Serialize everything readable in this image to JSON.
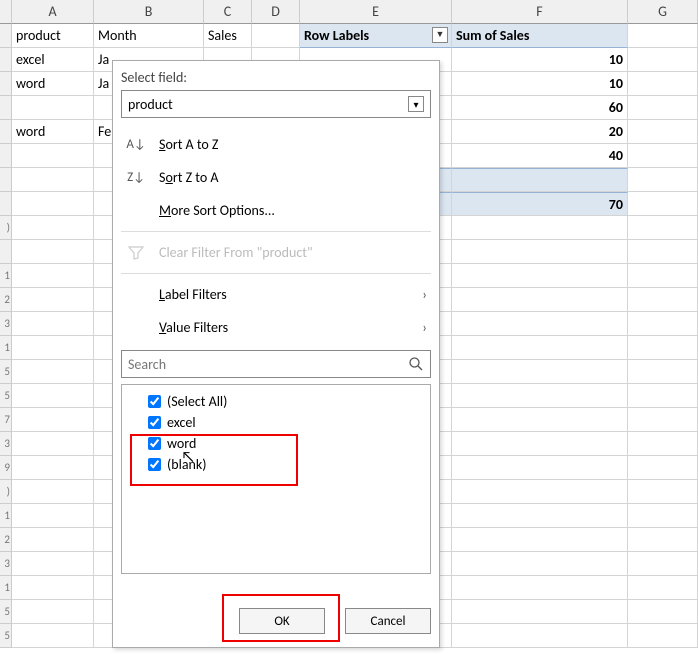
{
  "col_headers": [
    "A",
    "B",
    "C",
    "D",
    "E",
    "F",
    "G"
  ],
  "spreadsheet": {
    "r1": {
      "A": "product",
      "B": "Month",
      "C": "Sales",
      "E": "Row Labels",
      "F": "Sum of Sales"
    },
    "r2": {
      "A": "excel",
      "B": "Ja",
      "F": "10"
    },
    "r3": {
      "A": "word",
      "B": "Ja",
      "F": "10"
    },
    "r4": {
      "F": "60"
    },
    "r5": {
      "A": "word",
      "B": "Fe",
      "F": "20"
    },
    "r6": {
      "F": "40"
    },
    "r8": {
      "F": "70"
    }
  },
  "filter": {
    "select_field_label": "Select field:",
    "selected_field": "product",
    "sort_az": "Sort A to Z",
    "sort_za": "Sort Z to A",
    "more_sort": "More Sort Options...",
    "clear_filter": "Clear Filter From \"product\"",
    "label_filters": "Label Filters",
    "value_filters": "Value Filters",
    "search_placeholder": "Search",
    "items": [
      {
        "label": "(Select All)",
        "checked": true
      },
      {
        "label": "excel",
        "checked": true
      },
      {
        "label": "word",
        "checked": true
      },
      {
        "label": "(blank)",
        "checked": true
      }
    ],
    "ok": "OK",
    "cancel": "Cancel"
  }
}
